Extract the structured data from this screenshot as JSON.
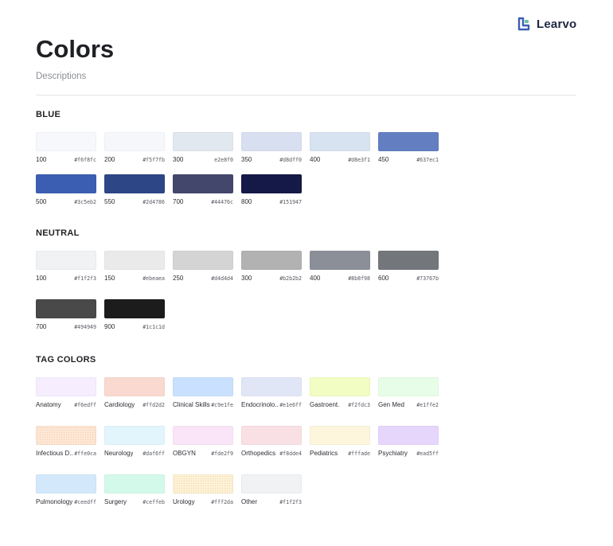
{
  "brand": {
    "name": "Learvo"
  },
  "page": {
    "title": "Colors",
    "description": "Descriptions"
  },
  "sections": [
    {
      "title": "BLUE",
      "swatches": [
        {
          "label": "100",
          "hex": "#f6f8fc",
          "color": "#f6f8fc"
        },
        {
          "label": "200",
          "hex": "#f5f7fb",
          "color": "#f5f7fb"
        },
        {
          "label": "300",
          "hex": "e2e8f0",
          "color": "#e2e8f0"
        },
        {
          "label": "350",
          "hex": "#d8dff0",
          "color": "#d8dff0"
        },
        {
          "label": "400",
          "hex": "#d8e3f1",
          "color": "#d8e3f1"
        },
        {
          "label": "450",
          "hex": "#637ec1",
          "color": "#637ec1"
        },
        {
          "label": "500",
          "hex": "#3c5eb2",
          "color": "#3c5eb2"
        },
        {
          "label": "550",
          "hex": "#2d4786",
          "color": "#2d4786"
        },
        {
          "label": "700",
          "hex": "#44476c",
          "color": "#44476c"
        },
        {
          "label": "800",
          "hex": "#151947",
          "color": "#151947"
        }
      ]
    },
    {
      "title": "NEUTRAL",
      "swatches": [
        {
          "label": "100",
          "hex": "#f1f2f3",
          "color": "#f1f2f3"
        },
        {
          "label": "150",
          "hex": "#ebeaea",
          "color": "#ebeaea"
        },
        {
          "label": "250",
          "hex": "#d4d4d4",
          "color": "#d4d4d4"
        },
        {
          "label": "300",
          "hex": "#b2b2b2",
          "color": "#b2b2b2"
        },
        {
          "label": "400",
          "hex": "#8b8f98",
          "color": "#8b8f98"
        },
        {
          "label": "600",
          "hex": "#73767b",
          "color": "#73767b"
        },
        {
          "label": "700",
          "hex": "#494949",
          "color": "#494949"
        },
        {
          "label": "900",
          "hex": "#1c1c1d",
          "color": "#1c1c1d"
        }
      ]
    },
    {
      "title": "TAG COLORS",
      "swatches": [
        {
          "label": "Anatomy",
          "hex": "#f6edff",
          "color": "#f6edff"
        },
        {
          "label": "Cardiology",
          "hex": "#ffd2d2",
          "color": "#f9d9d0"
        },
        {
          "label": "Clinical Skills",
          "hex": "#c9e1fe",
          "color": "#c9e1fe"
        },
        {
          "label": "Endocrinolo..",
          "hex": "#e1e6ff",
          "color": "#e1e6f7"
        },
        {
          "label": "Gastroent.",
          "hex": "#f2fdc3",
          "color": "#f2fdc3"
        },
        {
          "label": "Gen Med",
          "hex": "#e1ffe2",
          "color": "#e7fde7"
        },
        {
          "label": "Infectious D..",
          "hex": "#ffe0ca",
          "color": "#fde6d4"
        },
        {
          "label": "Neurology",
          "hex": "#daf6ff",
          "color": "#e2f5fd"
        },
        {
          "label": "OBGYN",
          "hex": "#fde2f9",
          "color": "#fae5f8"
        },
        {
          "label": "Orthopedics",
          "hex": "#f8dde4",
          "color": "#f8e0e4"
        },
        {
          "label": "Pediatrics",
          "hex": "#fffade",
          "color": "#fdf6dc"
        },
        {
          "label": "Psychiatry",
          "hex": "#ead5ff",
          "color": "#e7d6fb"
        },
        {
          "label": "Pulmonology",
          "hex": "#ceedff",
          "color": "#d3e9fb"
        },
        {
          "label": "Surgery",
          "hex": "#ceffeb",
          "color": "#d3f9ea"
        },
        {
          "label": "Urology",
          "hex": "#fff2da",
          "color": "#fdf1d8"
        },
        {
          "label": "Other",
          "hex": "#f1f2f3",
          "color": "#f1f2f3"
        }
      ]
    }
  ]
}
